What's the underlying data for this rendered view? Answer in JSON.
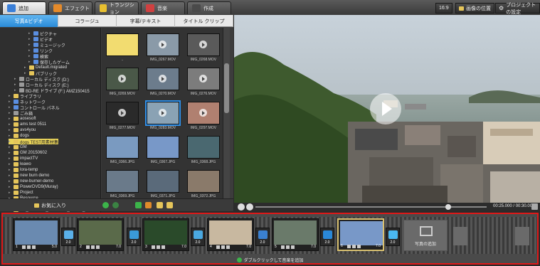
{
  "tabs": [
    {
      "label": "追加",
      "color": "#3a7fd8",
      "active": true
    },
    {
      "label": "エフェクト",
      "color": "#e58a2a",
      "active": false
    },
    {
      "label": "トランジション",
      "color": "#e8c030",
      "active": false
    },
    {
      "label": "音楽",
      "color": "#d04040",
      "active": false
    },
    {
      "label": "作成",
      "color": "#4a4a4a",
      "active": false
    }
  ],
  "toolbar": {
    "aspect_label": "16:9",
    "image_position_label": "画像の位置",
    "project_settings_label": "プロジェクトの設定"
  },
  "subtabs": [
    "写真&ビデオ",
    "コラージュ",
    "字幕/テキスト",
    "タイトル クリップ"
  ],
  "tree": [
    {
      "label": "ピクチャ",
      "icon": "blue",
      "indent": 40
    },
    {
      "label": "ビデオ",
      "icon": "blue",
      "indent": 40
    },
    {
      "label": "ミュージック",
      "icon": "blue",
      "indent": 40
    },
    {
      "label": "リンク",
      "icon": "blue",
      "indent": 40
    },
    {
      "label": "検索",
      "icon": "blue",
      "indent": 40
    },
    {
      "label": "保存したゲーム",
      "icon": "blue",
      "indent": 40
    },
    {
      "label": "Default.migrated",
      "icon": "folder",
      "indent": 34
    },
    {
      "label": "パブリック",
      "icon": "folder",
      "indent": 34
    },
    {
      "label": "ローカル ディスク (D:)",
      "icon": "drive",
      "indent": 20
    },
    {
      "label": "ローカル ディスク (E:)",
      "icon": "drive",
      "indent": 20
    },
    {
      "label": "BD-RE ドライブ (F:) AMZ150415",
      "icon": "drive",
      "indent": 20
    },
    {
      "label": "ライブラリ",
      "icon": "folder",
      "indent": 12
    },
    {
      "label": "ネットワーク",
      "icon": "blue",
      "indent": 12
    },
    {
      "label": "コントロール パネル",
      "icon": "blue",
      "indent": 12
    },
    {
      "label": "ごみ箱",
      "icon": "drive",
      "indent": 12
    },
    {
      "label": "aosesoft",
      "icon": "folder",
      "indent": 12
    },
    {
      "label": "ams test 0511",
      "icon": "folder",
      "indent": 12
    },
    {
      "label": "avs4you",
      "icon": "folder",
      "indent": 12
    },
    {
      "label": "dogs",
      "icon": "folder",
      "indent": 12
    },
    {
      "label": "dogs TEST用素材集",
      "icon": "folder",
      "indent": 12
    },
    {
      "label": "GM",
      "icon": "folder",
      "indent": 12
    },
    {
      "label": "GM 20150602",
      "icon": "folder",
      "indent": 12
    },
    {
      "label": "impactTV",
      "icon": "folder",
      "indent": 12
    },
    {
      "label": "leawo",
      "icon": "folder",
      "indent": 12
    },
    {
      "label": "lora-temp",
      "icon": "folder",
      "indent": 12
    },
    {
      "label": "new burn demo",
      "icon": "folder",
      "indent": 12
    },
    {
      "label": "new-burner-demo",
      "icon": "folder",
      "indent": 12
    },
    {
      "label": "PowerDVD9(Muray)",
      "icon": "folder",
      "indent": 12
    },
    {
      "label": "Project",
      "icon": "folder",
      "indent": 12
    },
    {
      "label": "Resource",
      "icon": "folder",
      "indent": 12
    },
    {
      "label": "Temp",
      "icon": "folder",
      "indent": 12
    },
    {
      "label": "TG_CD-ROM_20140522_Master_Final",
      "icon": "folder",
      "indent": 12
    }
  ],
  "tree_selected_index": 19,
  "thumbs": [
    {
      "name": "..",
      "bg": "#f2dc70",
      "play": false
    },
    {
      "name": "IMG_0267.MOV",
      "bg": "#8a9aa8",
      "play": true
    },
    {
      "name": "IMG_0268.MOV",
      "bg": "#5a5a5a",
      "play": true
    },
    {
      "name": "IMG_0269.MOV",
      "bg": "#4a5848",
      "play": true
    },
    {
      "name": "IMG_0270.MOV",
      "bg": "#6c7c8c",
      "play": true
    },
    {
      "name": "IMG_0276.MOV",
      "bg": "#7c7c7c",
      "play": true
    },
    {
      "name": "IMG_0277.MOV",
      "bg": "#2a2a2a",
      "play": true
    },
    {
      "name": "IMG_0283.MOV",
      "bg": "#8aa2b4",
      "play": true
    },
    {
      "name": "IMG_0297.MOV",
      "bg": "#b08070",
      "play": true
    },
    {
      "name": "IMG_0366.JPG",
      "bg": "#7a9ac0",
      "play": false
    },
    {
      "name": "IMG_0367.JPG",
      "bg": "#7898c8",
      "play": false
    },
    {
      "name": "IMG_0368.JPG",
      "bg": "#4a6870",
      "play": false
    },
    {
      "name": "IMG_0369.JPG",
      "bg": "#6a7a8a",
      "play": false
    },
    {
      "name": "IMG_0371.JPG",
      "bg": "#5a6a7a",
      "play": false
    },
    {
      "name": "IMG_0372.JPG",
      "bg": "#8a7a6a",
      "play": false
    }
  ],
  "selected_thumb_index": 7,
  "favorites_label": "お気に入り",
  "player": {
    "time": "00:25.000 / 00:30.000",
    "progress": 0.833
  },
  "clips": [
    {
      "num": "1",
      "dur": "5.0",
      "bg": "#6a8ab0"
    },
    {
      "num": "2",
      "dur": "7.0",
      "bg": "#5a6a4a"
    },
    {
      "num": "3",
      "dur": "7.0",
      "bg": "#2a4a2a"
    },
    {
      "num": "4",
      "dur": "7.0",
      "bg": "#c8b8a0"
    },
    {
      "num": "5",
      "dur": "7.0",
      "bg": "#6a7a6a"
    },
    {
      "num": "6",
      "dur": "7.0",
      "bg": "#7898c8"
    }
  ],
  "selected_clip_index": 5,
  "transitions": [
    {
      "dur": "2.0",
      "color": "#5ab0e8"
    },
    {
      "dur": "2.0",
      "color": "#3a9ad8"
    },
    {
      "dur": "2.0",
      "color": "#4aa8e0"
    },
    {
      "dur": "2.0",
      "color": "#3a80d0"
    },
    {
      "dur": "2.0",
      "color": "#2a88d8"
    },
    {
      "dur": "2.0",
      "color": "#4ab8f0"
    }
  ],
  "add_photo_label": "写真の追加",
  "music_hint": "ダブルクリックして音楽を追加"
}
